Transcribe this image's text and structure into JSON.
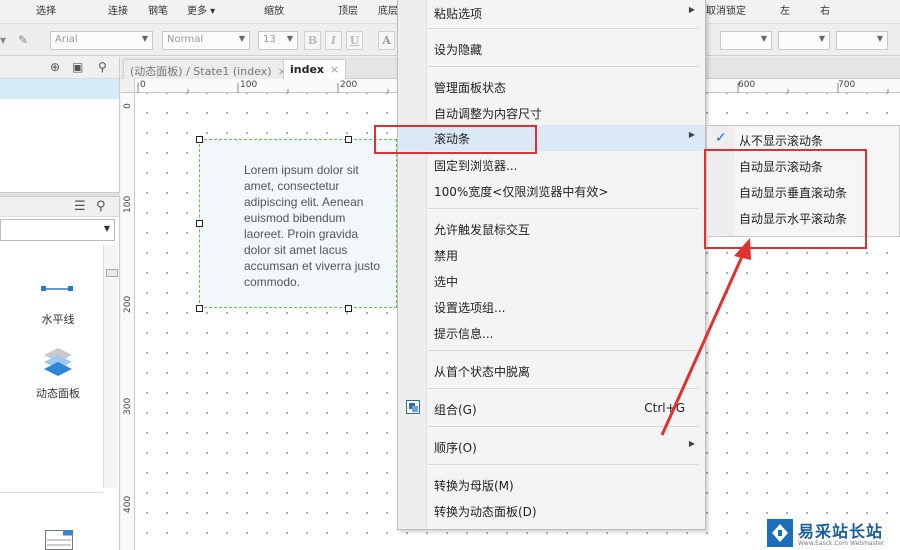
{
  "toolbar": {
    "row1": [
      "选择",
      "连接",
      "钢笔",
      "更多 ▾",
      "缩放",
      "顶层",
      "底层",
      "取消锁定",
      "左",
      "右"
    ],
    "font_family": "Arial",
    "font_style": "Normal",
    "font_size": "13",
    "bold": "B",
    "italic": "I",
    "underline": "U",
    "font_color": "A"
  },
  "left_panel": {
    "widgets": [
      {
        "label": "水平线"
      },
      {
        "label": "动态面板"
      }
    ]
  },
  "tabs": [
    {
      "label": "(动态面板) / State1 (index)",
      "active": false
    },
    {
      "label": "index",
      "active": true
    }
  ],
  "ruler": {
    "h_ticks": [
      "0",
      "100",
      "200",
      "600",
      "700"
    ],
    "v_ticks": [
      "0",
      "100",
      "200",
      "300",
      "400"
    ]
  },
  "canvas": {
    "dynamic_panel_text": "Lorem ipsum dolor sit amet, consectetur adipiscing elit. Aenean euismod bibendum laoreet. Proin gravida dolor sit amet lacus accumsan et viverra justo commodo."
  },
  "context_menu": {
    "items": [
      {
        "label": "粘贴选项",
        "submenu": true
      },
      {
        "label": "设为隐藏"
      },
      {
        "label": "管理面板状态"
      },
      {
        "label": "自动调整为内容尺寸"
      },
      {
        "label": "滚动条",
        "submenu": true,
        "highlighted": true
      },
      {
        "label": "固定到浏览器..."
      },
      {
        "label": "100%宽度<仅限浏览器中有效>"
      },
      {
        "label": "允许触发鼠标交互"
      },
      {
        "label": "禁用"
      },
      {
        "label": "选中"
      },
      {
        "label": "设置选项组..."
      },
      {
        "label": "提示信息..."
      },
      {
        "label": "从首个状态中脱离"
      },
      {
        "label": "组合(G)",
        "shortcut": "Ctrl+G"
      },
      {
        "label": "顺序(O)",
        "submenu": true
      },
      {
        "label": "转换为母版(M)"
      },
      {
        "label": "转换为动态面板(D)"
      }
    ]
  },
  "scrollbar_submenu": {
    "items": [
      {
        "label": "从不显示滚动条",
        "checked": true
      },
      {
        "label": "自动显示滚动条"
      },
      {
        "label": "自动显示垂直滚动条"
      },
      {
        "label": "自动显示水平滚动条"
      }
    ]
  },
  "watermark": {
    "title": "易采站长站",
    "subtitle": "Www.Easck.Com Webmaster"
  },
  "colors": {
    "annotation_red": "#e03030",
    "menu_highlight": "#dbe8f5",
    "panel_border": "#63c34e",
    "check_blue": "#2a6cc4"
  }
}
